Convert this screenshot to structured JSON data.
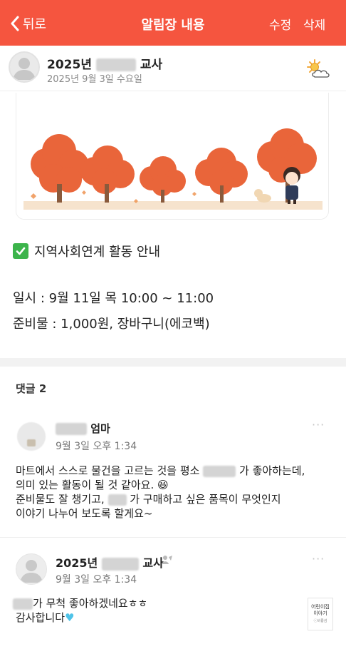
{
  "topbar": {
    "back_label": "뒤로",
    "title": "알림장 내용",
    "edit_label": "수정",
    "delete_label": "삭제",
    "color": "#f5553f"
  },
  "post": {
    "author_prefix": "2025년",
    "author_suffix": "교사",
    "date": "2025년 9월 3일 수요일",
    "weather_icon": "partly-cloudy-sun-icon",
    "heading": "지역사회연계 활동 안내",
    "heading_icon": "check-mark-button-icon",
    "schedule": "일시 : 9월 11일 목 10:00 ~ 11:00",
    "supplies": "준비물 : 1,000원, 장바구니(에코백)"
  },
  "comments": {
    "header": "댓글 2",
    "items": [
      {
        "name_suffix": "엄마",
        "time": "9월 3일 오후 1:34",
        "line1_before": "마트에서 스스로 물건을 고르는 것을 평소",
        "line1_after": "가 좋아하는데,",
        "line2": "의미 있는 활동이 될 것 같아요. 😆",
        "line3_before": "준비물도 잘 챙기고,",
        "line3_after": "가 구매하고 싶은 품목이 무엇인지",
        "line4": "이야기 나누어 보도록 할게요~",
        "more_label": "···"
      },
      {
        "name_prefix": "2025년",
        "name_suffix": "교사",
        "time": "9월 3일 오후 1:34",
        "line1_after": "가 무척 좋아하겠네요ㅎㅎ",
        "line2": "감사합니다",
        "more_label": "···",
        "stamp_line1": "어린이집",
        "stamp_line2": "이야기",
        "stamp_line3": "ⓒ비룡섬"
      }
    ]
  },
  "colors": {
    "accent": "#f5553f",
    "tree_orange": "#e9653a",
    "check_green": "#3cb44b",
    "heart_blue": "#4fc3e8"
  }
}
